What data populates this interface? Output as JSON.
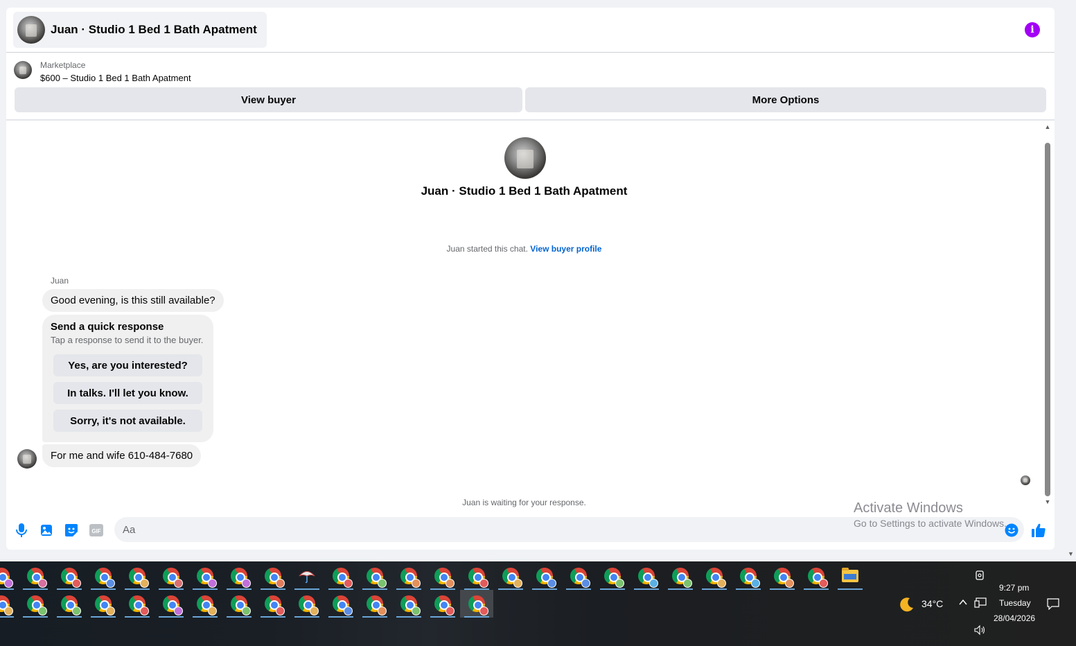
{
  "header": {
    "title": "Juan · Studio 1 Bed 1 Bath Apatment"
  },
  "listing": {
    "label": "Marketplace",
    "title": "$600 – Studio 1 Bed 1 Bath Apatment"
  },
  "buttons": {
    "view_buyer": "View buyer",
    "more_options": "More Options"
  },
  "chat": {
    "title": "Juan · Studio 1 Bed 1 Bath Apatment",
    "started_text": "Juan started this chat.",
    "started_link": "View buyer profile",
    "sender_name": "Juan",
    "message_1": "Good evening, is this still available?",
    "quick_title": "Send a quick response",
    "quick_sub": "Tap a response to send it to the buyer.",
    "quick_responses": [
      "Yes, are you interested?",
      "In talks. I'll let you know.",
      "Sorry, it's not available."
    ],
    "message_2": "For me and wife  610-484-7680",
    "waiting": "Juan is waiting for your response."
  },
  "composer": {
    "placeholder": "Aa",
    "gif_label": "GIF"
  },
  "watermark": {
    "line1": "Activate Windows",
    "line2": "Go to Settings to activate Windows."
  },
  "taskbar": {
    "row1_profile_colors": [
      "#c26fd9",
      "#d96f9f",
      "#e35b5b",
      "#5b8de3",
      "#e3b05b",
      "#d96f6f",
      "#c26fd9",
      "#c26fd9",
      "#e37c5b",
      "umbrella",
      "#e35b5b",
      "#7bc26f",
      "#e3905b",
      "#e3905b",
      "#e35b5b",
      "#e3b05b",
      "#5b8de3",
      "#5b8de3",
      "#7bc26f",
      "#5bb0e3",
      "#7bc26f",
      "#e3b05b",
      "#5bb0e3",
      "#e3905b",
      "#e35b5b",
      "folder"
    ],
    "row2_profile_colors": [
      "#e3b05b",
      "#7bc26f",
      "#7bc26f",
      "#e3b05b",
      "#e35b5b",
      "#c26fd9",
      "#e3b05b",
      "#7bc26f",
      "#e35b5b",
      "#e3b05b",
      "#5b8de3",
      "#e3905b",
      "#7bc26f",
      "#e35b5b",
      "#e35b5b"
    ],
    "weather": "34°C",
    "time": "9:27 pm",
    "day": "Tuesday",
    "date": "28/04/2026"
  },
  "colors": {
    "accent": "#0084ff",
    "info": "#a200f5",
    "link": "#0064d1"
  }
}
